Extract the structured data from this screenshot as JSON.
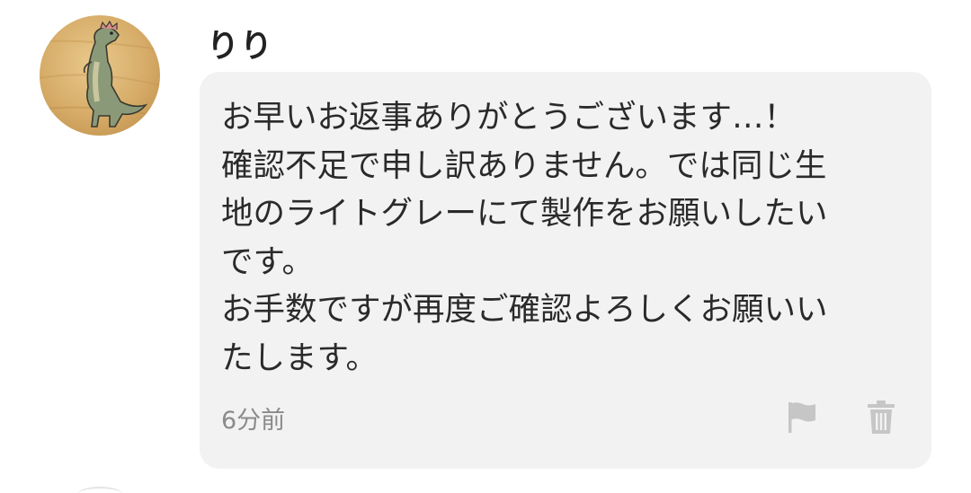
{
  "comment": {
    "author": "りり",
    "avatar_icon": "dinosaur-drawing-avatar",
    "message_lines": [
      "お早いお返事ありがとうございます…！",
      "確認不足で申し訳ありません。では同じ生",
      "地のライトグレーにて製作をお願いしたい",
      "です。",
      "お手数ですが再度ご確認よろしくお願いい",
      "たします。"
    ],
    "timestamp": "6分前",
    "actions": {
      "flag_icon": "flag-icon",
      "delete_icon": "trash-icon"
    }
  },
  "colors": {
    "bubble": "#f2f2f2",
    "text": "#2a2a2a",
    "meta": "#8a8a8a",
    "icon": "#c6c6c6"
  }
}
